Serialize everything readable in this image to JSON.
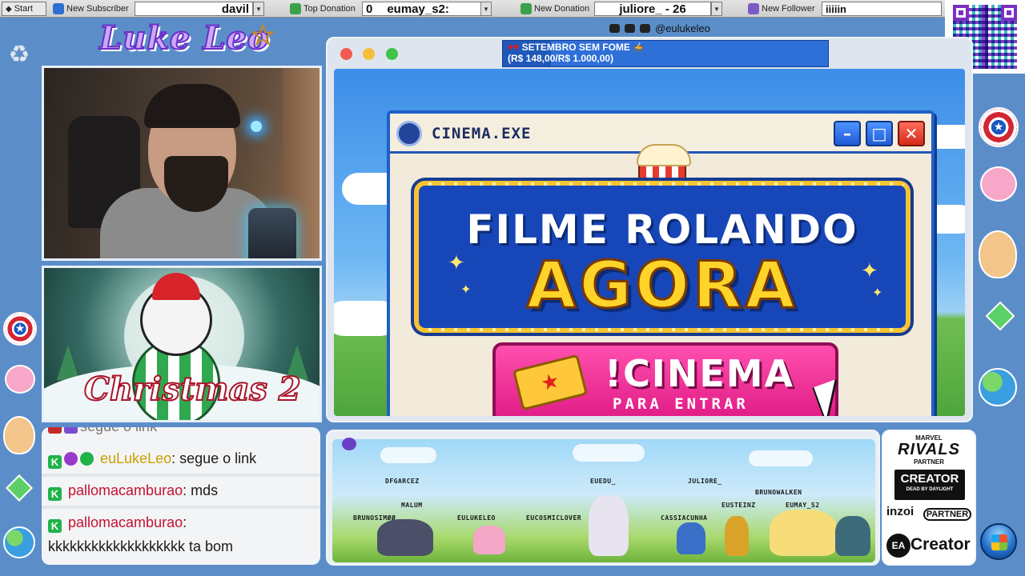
{
  "taskbar": {
    "start_label": "Start",
    "new_subscriber_label": "New Subscriber",
    "new_subscriber_value": "davil",
    "top_donation_label": "Top Donation",
    "top_donation_value": "0",
    "eumay_value": "eumay_s2:",
    "new_donation_label": "New Donation",
    "new_donation_value": "juliore_ - 26",
    "new_follower_label": "New Follower",
    "new_follower_value": "iiiiin"
  },
  "brand": {
    "logo_text": "Luke Leo"
  },
  "social": {
    "handle": "@eulukeleo"
  },
  "goal": {
    "title": "SETEMBRO SEM FOME",
    "progress": "(R$ 148,00/R$ 1.000,00)",
    "fraction": 0.148
  },
  "christmas": {
    "title": "Christmas 2"
  },
  "chat": {
    "top_partial": "segue o link",
    "messages": [
      {
        "user": "euLukeLeo",
        "text": ": segue o link",
        "user_color": "#c8a100"
      },
      {
        "user": "pallomacamburao",
        "text": ": mds",
        "user_color": "#c4122f"
      },
      {
        "user": "pallomacamburao",
        "text": ":",
        "text2": "kkkkkkkkkkkkkkkkkkk ta bom",
        "user_color": "#c4122f"
      }
    ]
  },
  "cinema": {
    "window_title": "CINEMA.EXE",
    "minimize": "–",
    "maximize": "□",
    "close": "✕",
    "headline": "FILME ROLANDO",
    "subheadline": "AGORA",
    "command": "!CINEMA",
    "instruction": "PARA ENTRAR"
  },
  "players": [
    "DFGARCEZ",
    "EUEDU_",
    "JULIORE_",
    "BRUNOWALKEN",
    "MALUM",
    "EUSTEINZ",
    "EUMAY_S2",
    "BRUNOSIMØØ",
    "EULUKELEO",
    "EUCOSMICLOVER",
    "CASSIACUNHA"
  ],
  "partner": {
    "marvel": "MARVEL",
    "rivals": "RIVALS",
    "partner_label": "PARTNER",
    "creator": "CREATOR",
    "dbd": "DEAD BY DAYLIGHT",
    "inzoi": "inzoi",
    "inzoi_partner": "PARTNER",
    "ea": "EA",
    "ea_creator": "Creator"
  },
  "colors": {
    "desktop": "#5b8ec9",
    "accent_blue": "#1f5fc7",
    "accent_pink": "#e01c86",
    "accent_yellow": "#ffd42a"
  },
  "icons": [
    "recycle-bin-icon",
    "popcorn-icon",
    "film-reel-icon",
    "ticket-icon",
    "cursor-icon",
    "shield-icon",
    "windows-start-icon"
  ]
}
